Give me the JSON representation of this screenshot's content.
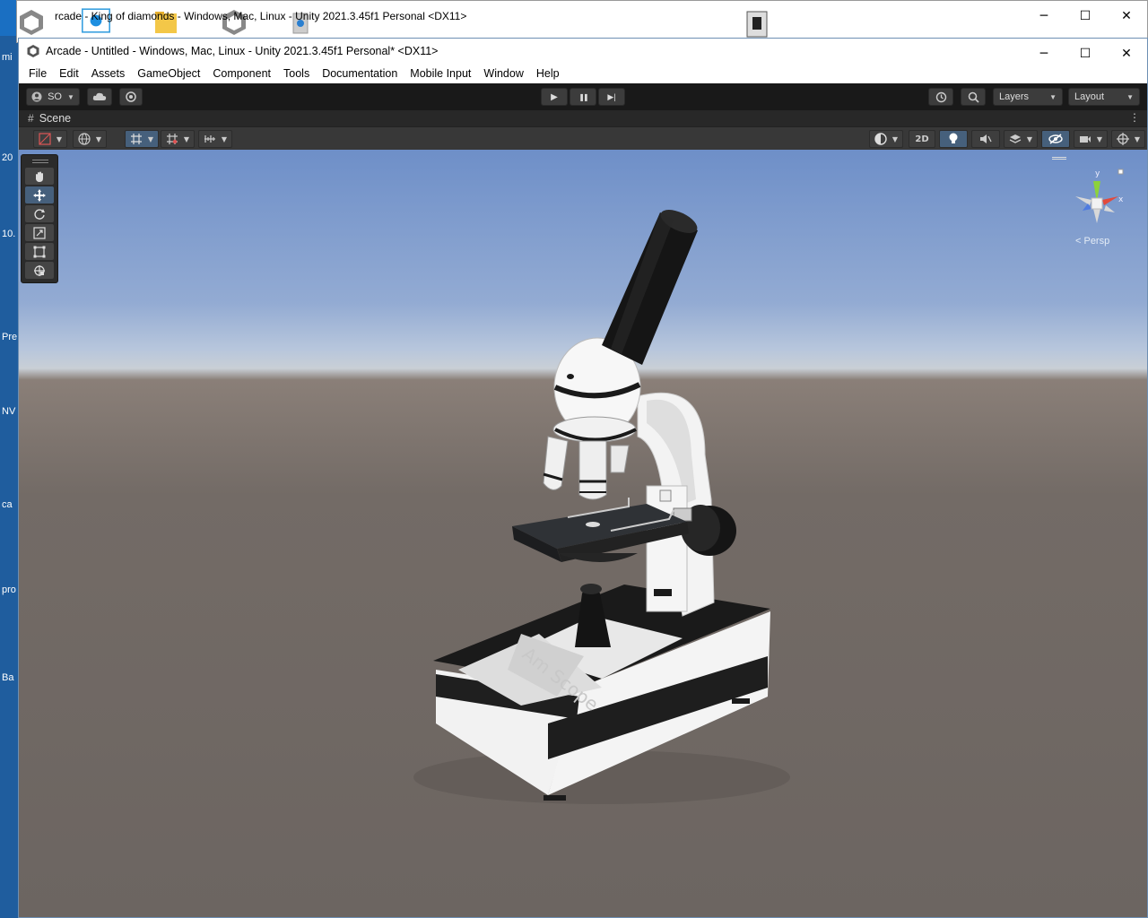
{
  "back_window": {
    "title": "rcade - King of diamonds - Windows, Mac, Linux - Unity 2021.3.45f1 Personal <DX11>"
  },
  "desktop": {
    "left_labels": [
      "mi",
      "20",
      "10.",
      "Pre",
      "NV",
      "ca",
      "pro",
      "Ba"
    ]
  },
  "window": {
    "title": "Arcade - Untitled - Windows, Mac, Linux - Unity 2021.3.45f1 Personal* <DX11>",
    "minimize": "─",
    "maximize": "☐",
    "close": "✕"
  },
  "menu": {
    "items": [
      "File",
      "Edit",
      "Assets",
      "GameObject",
      "Component",
      "Tools",
      "Documentation",
      "Mobile Input",
      "Window",
      "Help"
    ]
  },
  "toolbar": {
    "account_label": "SO",
    "layers_label": "Layers",
    "layout_label": "Layout",
    "play_icon": "▶",
    "pause_icon": "❚❚",
    "step_icon": "▶|"
  },
  "scene_tab": {
    "label": "Scene",
    "hash": "#",
    "menu": "⋮"
  },
  "scene_toolbar": {
    "mode_2d": "2D"
  },
  "viewport": {
    "persp_label": "< Persp",
    "gizmo_y": "y",
    "gizmo_x": "x",
    "model_text": "Am Scope"
  },
  "colors": {
    "toolbar_bg": "#191919",
    "scene_toolbar_bg": "#383838",
    "active_button": "#46607c",
    "sky_top": "#6e8fc8",
    "ground": "#736b66"
  }
}
